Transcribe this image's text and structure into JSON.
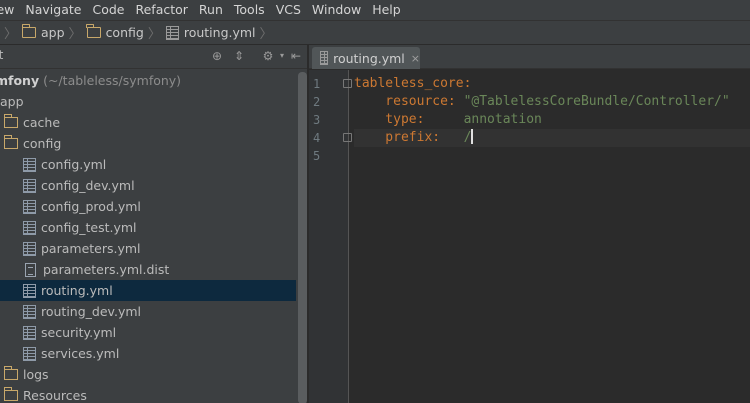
{
  "menu": {
    "items": [
      "iew",
      "Navigate",
      "Code",
      "Refactor",
      "Run",
      "Tools",
      "VCS",
      "Window",
      "Help"
    ]
  },
  "breadcrumb": {
    "items": [
      {
        "label": "app",
        "icon": "folder-icon"
      },
      {
        "label": "config",
        "icon": "folder-icon"
      },
      {
        "label": "routing.yml",
        "icon": "yaml-file-icon"
      }
    ]
  },
  "project_panel": {
    "view_selector": "ct",
    "root_label": "mfony",
    "root_path": "(~/tableless/symfony)",
    "tree": [
      {
        "label": "app",
        "type": "folder-open"
      },
      {
        "label": "cache",
        "type": "folder"
      },
      {
        "label": "config",
        "type": "folder-open"
      },
      {
        "label": "config.yml",
        "type": "yaml"
      },
      {
        "label": "config_dev.yml",
        "type": "yaml"
      },
      {
        "label": "config_prod.yml",
        "type": "yaml"
      },
      {
        "label": "config_test.yml",
        "type": "yaml"
      },
      {
        "label": "parameters.yml",
        "type": "yaml"
      },
      {
        "label": "parameters.yml.dist",
        "type": "text"
      },
      {
        "label": "routing.yml",
        "type": "yaml",
        "selected": true
      },
      {
        "label": "routing_dev.yml",
        "type": "yaml"
      },
      {
        "label": "security.yml",
        "type": "yaml"
      },
      {
        "label": "services.yml",
        "type": "yaml"
      },
      {
        "label": "logs",
        "type": "folder"
      },
      {
        "label": "Resources",
        "type": "folder"
      }
    ]
  },
  "editor": {
    "tab_label": "routing.yml",
    "tab_close": "×",
    "line_numbers": [
      "1",
      "2",
      "3",
      "4",
      "5"
    ],
    "lines": [
      {
        "key": "tableless_core:",
        "value": ""
      },
      {
        "key": "    resource: ",
        "value": "\"@TablelessCoreBundle/Controller/\""
      },
      {
        "key": "    type:     ",
        "value": "annotation"
      },
      {
        "key": "    prefix:   ",
        "value": "/"
      },
      {
        "key": "",
        "value": ""
      }
    ],
    "current_line": 4
  },
  "colors": {
    "background": "#2b2b2b",
    "panel": "#3c3f41",
    "selection": "#0d293e",
    "yaml_key": "#cc7832",
    "yaml_value": "#6a8759"
  }
}
